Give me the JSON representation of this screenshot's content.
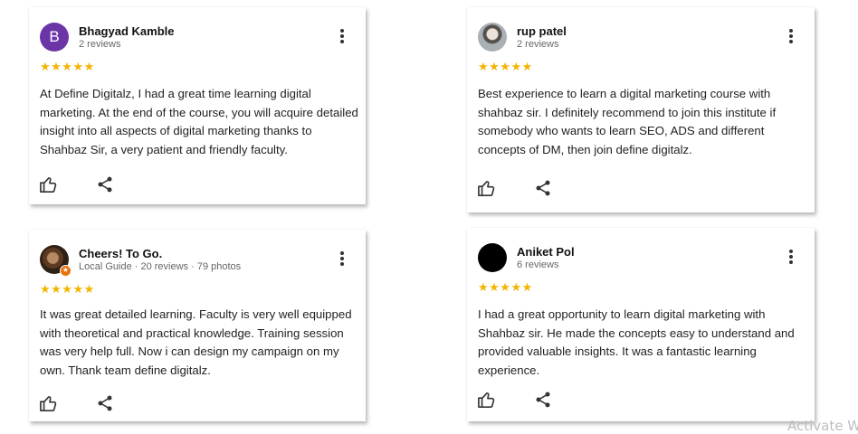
{
  "reviews": [
    {
      "avatar_letter": "B",
      "name": "Bhagyad Kamble",
      "meta": "2 reviews",
      "stars": "★★★★★",
      "text": "At Define Digitalz, I had a great time learning digital marketing. At the end of the course, you will acquire detailed insight into all aspects of digital marketing thanks to Shahbaz Sir, a very patient and friendly faculty."
    },
    {
      "name": "rup patel",
      "meta": "2 reviews",
      "stars": "★★★★★",
      "text": "Best experience to learn a digital marketing course with shahbaz sir. I definitely recommend to join this institute if somebody who wants to learn SEO, ADS and different concepts of DM, then join define digitalz."
    },
    {
      "name": "Cheers! To Go.",
      "meta": "Local Guide · 20 reviews · 79 photos",
      "stars": "★★★★★",
      "text": "It was great detailed learning. Faculty is very well equipped with theoretical and practical knowledge. Training session was very help full. Now i can design my campaign on my own. Thank team define digitalz."
    },
    {
      "name": "Aniket Pol",
      "meta": "6 reviews",
      "stars": "★★★★★",
      "text": "I had a great opportunity to learn digital marketing with Shahbaz sir. He made the concepts easy to understand and provided valuable insights. It was a fantastic learning experience."
    }
  ],
  "watermark": "Activate W",
  "colors": {
    "star": "#f4b400",
    "avatar_purple": "#6b35a8",
    "local_guide_badge": "#e8710a"
  },
  "icons": [
    "thumbs-up-icon",
    "share-icon",
    "more-vert-icon",
    "star-icon"
  ]
}
